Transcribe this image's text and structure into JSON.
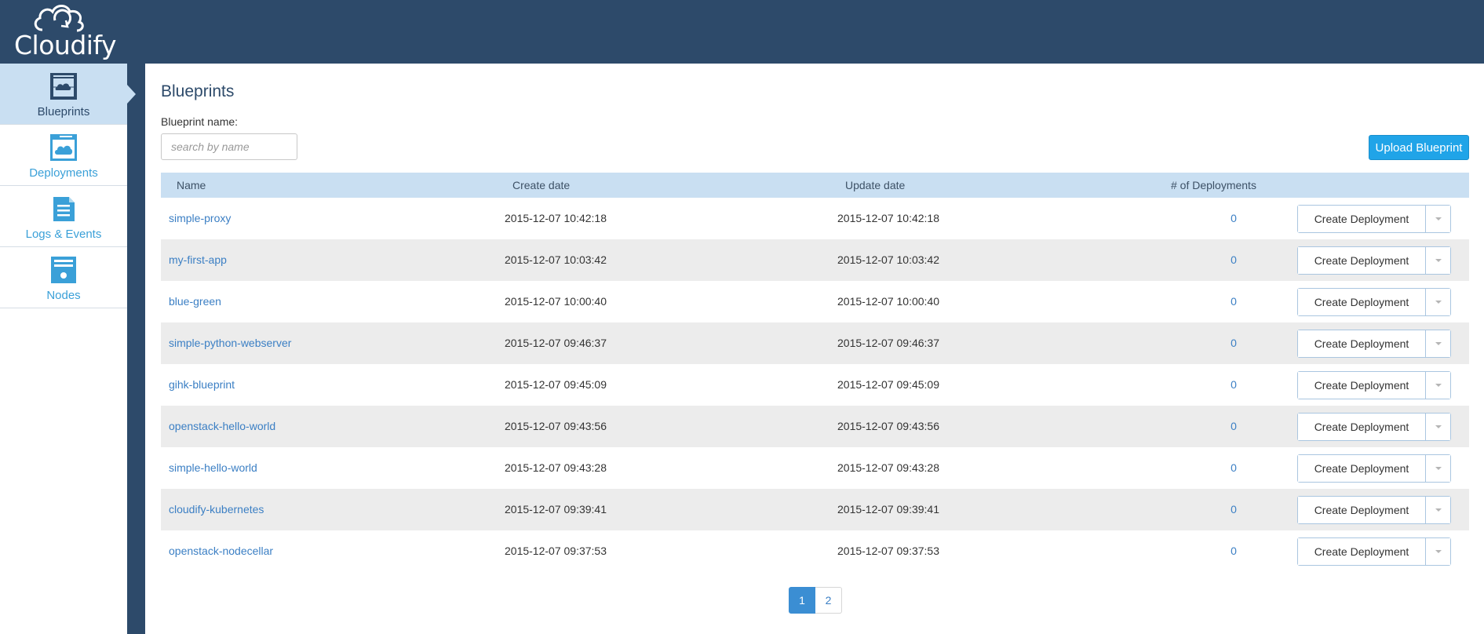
{
  "app": {
    "logo_text": "Cloudify"
  },
  "sidebar": {
    "items": [
      {
        "label": "Blueprints",
        "icon": "blueprints-icon",
        "active": true
      },
      {
        "label": "Deployments",
        "icon": "deployments-icon",
        "active": false
      },
      {
        "label": "Logs & Events",
        "icon": "logs-icon",
        "active": false
      },
      {
        "label": "Nodes",
        "icon": "nodes-icon",
        "active": false
      }
    ]
  },
  "main": {
    "title": "Blueprints",
    "filter_label": "Blueprint name:",
    "search_placeholder": "search by name",
    "upload_label": "Upload Blueprint"
  },
  "table": {
    "headers": {
      "name": "Name",
      "created": "Create date",
      "updated": "Update date",
      "count": "# of Deployments"
    },
    "action_label": "Create Deployment",
    "rows": [
      {
        "name": "simple-proxy",
        "created": "2015-12-07 10:42:18",
        "updated": "2015-12-07 10:42:18",
        "count": "0"
      },
      {
        "name": "my-first-app",
        "created": "2015-12-07 10:03:42",
        "updated": "2015-12-07 10:03:42",
        "count": "0"
      },
      {
        "name": "blue-green",
        "created": "2015-12-07 10:00:40",
        "updated": "2015-12-07 10:00:40",
        "count": "0"
      },
      {
        "name": "simple-python-webserver",
        "created": "2015-12-07 09:46:37",
        "updated": "2015-12-07 09:46:37",
        "count": "0"
      },
      {
        "name": "gihk-blueprint",
        "created": "2015-12-07 09:45:09",
        "updated": "2015-12-07 09:45:09",
        "count": "0"
      },
      {
        "name": "openstack-hello-world",
        "created": "2015-12-07 09:43:56",
        "updated": "2015-12-07 09:43:56",
        "count": "0"
      },
      {
        "name": "simple-hello-world",
        "created": "2015-12-07 09:43:28",
        "updated": "2015-12-07 09:43:28",
        "count": "0"
      },
      {
        "name": "cloudify-kubernetes",
        "created": "2015-12-07 09:39:41",
        "updated": "2015-12-07 09:39:41",
        "count": "0"
      },
      {
        "name": "openstack-nodecellar",
        "created": "2015-12-07 09:37:53",
        "updated": "2015-12-07 09:37:53",
        "count": "0"
      }
    ]
  },
  "pagination": {
    "pages": [
      "1",
      "2"
    ],
    "current": "1"
  },
  "colors": {
    "header": "#2d4a6a",
    "accent": "#20a4e8",
    "link": "#3b7fc4",
    "table_head": "#c9dff2"
  }
}
